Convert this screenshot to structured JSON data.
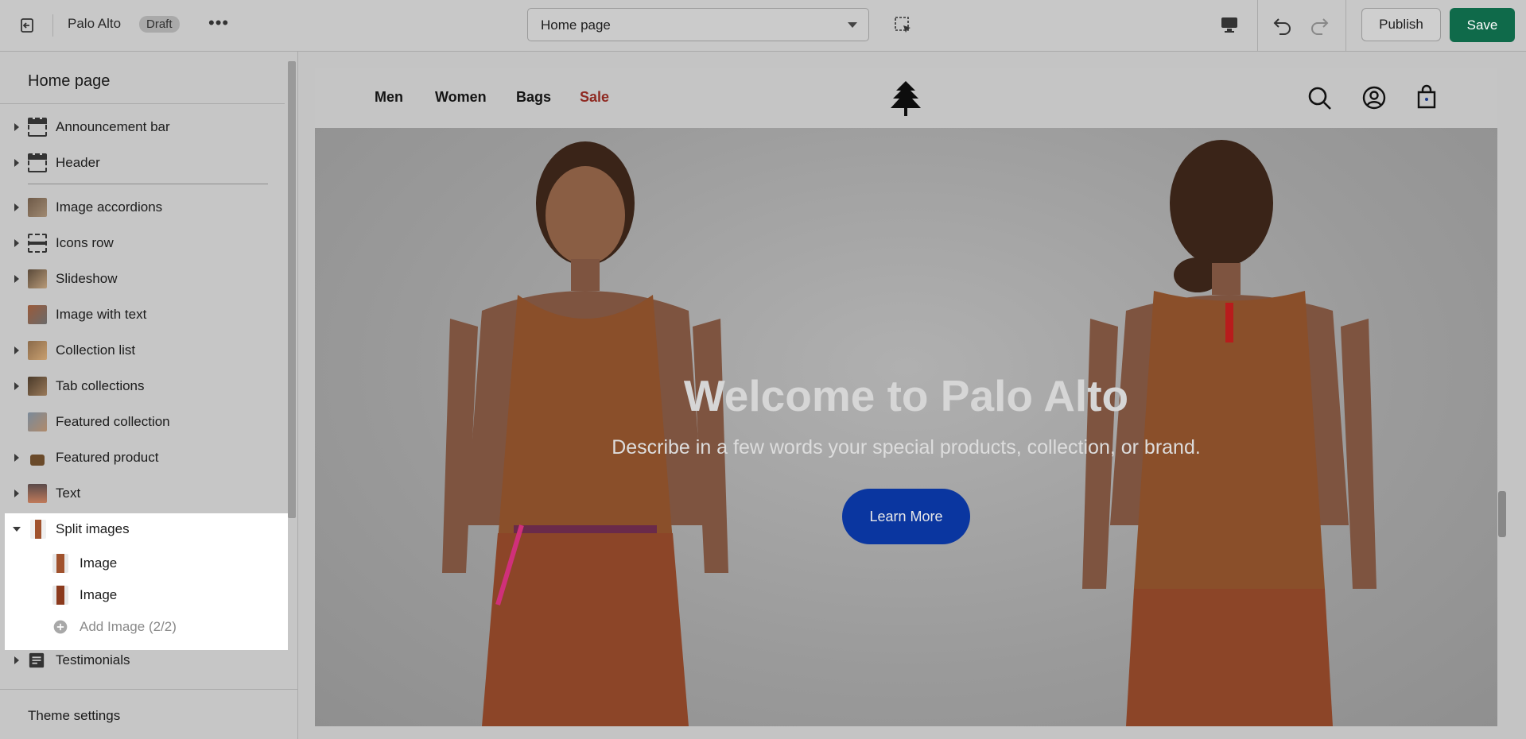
{
  "topbar": {
    "store_name": "Palo Alto",
    "status_badge": "Draft",
    "more_label": "•••",
    "page_select_value": "Home page",
    "publish_label": "Publish",
    "save_label": "Save"
  },
  "sidebar": {
    "title": "Home page",
    "items": [
      {
        "label": "Announcement bar"
      },
      {
        "label": "Header"
      },
      {
        "label": "Image accordions"
      },
      {
        "label": "Icons row"
      },
      {
        "label": "Slideshow"
      },
      {
        "label": "Image with text"
      },
      {
        "label": "Collection list"
      },
      {
        "label": "Tab collections"
      },
      {
        "label": "Featured collection"
      },
      {
        "label": "Featured product"
      },
      {
        "label": "Text"
      },
      {
        "label": "Split images"
      },
      {
        "label": "Image"
      },
      {
        "label": "Image"
      },
      {
        "label": "Add Image (2/2)"
      },
      {
        "label": "Testimonials"
      }
    ],
    "footer": "Theme settings"
  },
  "preview": {
    "nav": [
      "Men",
      "Women",
      "Bags",
      "Sale"
    ],
    "sale_color": "#8f2a22",
    "hero_title": "Welcome to Palo Alto",
    "hero_subtitle": "Describe in a few words your special products, collection, or brand.",
    "hero_button": "Learn More",
    "button_color": "#0a36a0"
  },
  "colors": {
    "save_button": "#0f6a4a",
    "highlight": "#ffffff"
  }
}
